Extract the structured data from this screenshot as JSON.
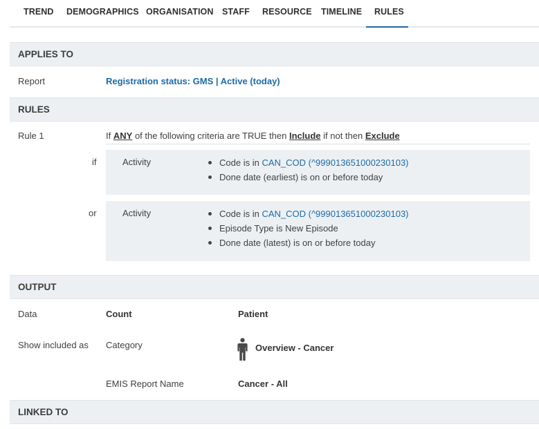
{
  "tabs": [
    {
      "label": "TREND"
    },
    {
      "label": "DEMOGRAPHICS"
    },
    {
      "label": "ORGANISATION"
    },
    {
      "label": "STAFF"
    },
    {
      "label": "RESOURCE"
    },
    {
      "label": "TIMELINE"
    },
    {
      "label": "RULES",
      "active": true
    }
  ],
  "applies_to": {
    "heading": "APPLIES TO",
    "report_label": "Report",
    "report_value": "Registration status: GMS | Active (today)"
  },
  "rules": {
    "heading": "RULES",
    "rule_label": "Rule 1",
    "sentence": {
      "prefix": "If",
      "quantifier": "ANY",
      "middle": "of the following criteria are TRUE then",
      "then_action": "Include",
      "else_text": "if not then",
      "else_action": "Exclude"
    },
    "groups": [
      {
        "connector": "if",
        "type": "Activity",
        "criteria": {
          "c1_prefix": "Code is in",
          "c1_link": "CAN_COD (^999013651000230103)",
          "c2": "Done date (earliest) is on or before today"
        }
      },
      {
        "connector": "or",
        "type": "Activity",
        "criteria": {
          "c1_prefix": "Code is in",
          "c1_link": "CAN_COD (^999013651000230103)",
          "c2": "Episode Type is New Episode",
          "c3": "Done date (latest) is on or before today"
        }
      }
    ]
  },
  "output": {
    "heading": "OUTPUT",
    "data_label": "Data",
    "data_type": "Count",
    "data_value": "Patient",
    "show_label": "Show included as",
    "category_label": "Category",
    "category_value": "Overview - Cancer",
    "category_icon": "person-icon",
    "report_name_label": "EMIS Report Name",
    "report_name_value": "Cancer - All"
  },
  "linked_to": {
    "heading": "LINKED TO"
  },
  "colors": {
    "accent": "#1d6aa5",
    "section_bg": "#edf0f3"
  }
}
